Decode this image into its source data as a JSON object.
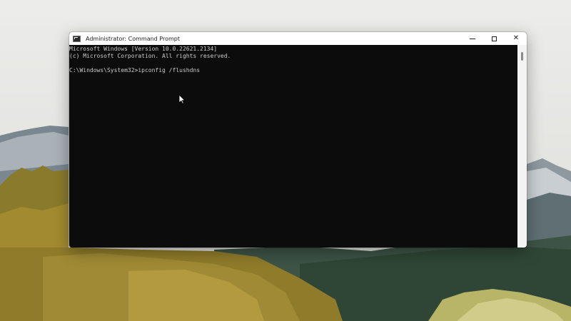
{
  "window": {
    "title": "Administrator: Command Prompt",
    "icon": "cmd-icon",
    "controls": {
      "minimize": "minimize-icon",
      "maximize": "maximize-icon",
      "close": "✕"
    }
  },
  "console": {
    "lines": [
      "Microsoft Windows [Version 10.0.22621.2134]",
      "(c) Microsoft Corporation. All rights reserved.",
      "",
      "C:\\Windows\\System32>ipconfig /flushdns"
    ]
  },
  "colors": {
    "console_bg": "#0c0c0c",
    "console_text": "#cccccc",
    "titlebar_bg": "#ffffff"
  },
  "pointer": "arrow-cursor-icon"
}
